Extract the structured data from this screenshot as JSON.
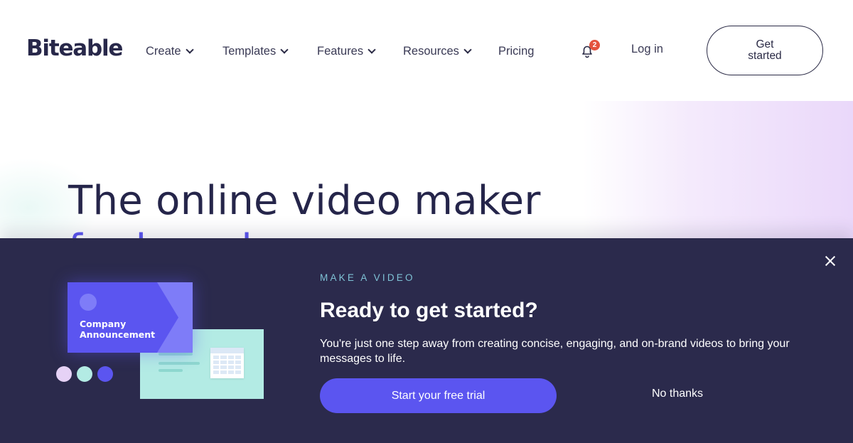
{
  "header": {
    "logo": "Biteable",
    "nav": [
      {
        "label": "Create",
        "has_dropdown": true
      },
      {
        "label": "Templates",
        "has_dropdown": true
      },
      {
        "label": "Features",
        "has_dropdown": true
      },
      {
        "label": "Resources",
        "has_dropdown": true
      },
      {
        "label": "Pricing",
        "has_dropdown": false
      }
    ],
    "notifications": {
      "icon": "bell-icon",
      "count": "2"
    },
    "login_label": "Log in",
    "get_started_label": "Get started"
  },
  "hero": {
    "title": "The online video maker",
    "title_line2": "for brands"
  },
  "banner": {
    "eyebrow": "MAKE A VIDEO",
    "title": "Ready to get started?",
    "body": "You're just one step away from creating concise, engaging, and on-brand videos to bring your messages to life.",
    "cta_label": "Start your free trial",
    "dismiss_label": "No thanks",
    "close_icon": "close-icon",
    "illustration": {
      "card_label": "Company Announcement",
      "swatches": [
        "#e6d2f6",
        "#b3ebe4",
        "#5b55f0"
      ]
    }
  },
  "colors": {
    "brand_dark": "#2b2a4c",
    "accent": "#5b55f0",
    "eyebrow": "#7fc3d6",
    "badge": "#e4533e"
  }
}
